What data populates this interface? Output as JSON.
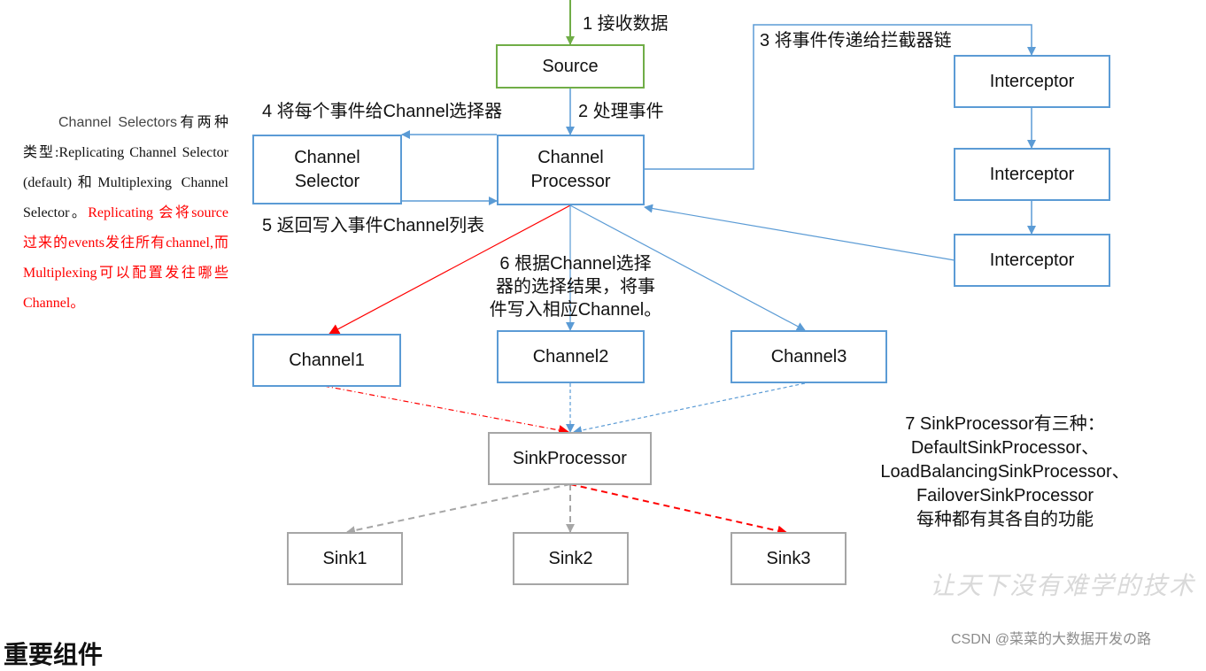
{
  "nodes": {
    "source": "Source",
    "channel_selector": [
      "Channel",
      "Selector"
    ],
    "channel_processor": [
      "Channel",
      "Processor"
    ],
    "interceptors": [
      "Interceptor",
      "Interceptor",
      "Interceptor"
    ],
    "channels": [
      "Channel1",
      "Channel2",
      "Channel3"
    ],
    "sink_processor": "SinkProcessor",
    "sinks": [
      "Sink1",
      "Sink2",
      "Sink3"
    ]
  },
  "steps": {
    "step1": "1 接收数据",
    "step2": "2 处理事件",
    "step3": "3 将事件传递给拦截器链",
    "step4": "4 将每个事件给Channel选择器",
    "step5": "5 返回写入事件Channel列表",
    "step6": [
      "6 根据Channel选择",
      "器的选择结果，将事",
      "件写入相应Channel。"
    ],
    "step7": [
      "7 SinkProcessor有三种：",
      "DefaultSinkProcessor、",
      "LoadBalancingSinkProcessor、",
      "FailoverSinkProcessor",
      "每种都有其各自的功能"
    ]
  },
  "side_note": {
    "black_part": [
      "Channel  Selectors",
      "有两种类型:Replicating Channel Selector (default)和Multiplexing Channel Selector。"
    ],
    "red_part": "Replicating 会将source过来的events发往所有channel,而Multiplexing可以配置发往哪些Channel。"
  },
  "colors": {
    "blue": "#5b9bd5",
    "green": "#70ad47",
    "gray": "#a6a6a6",
    "red": "#ff0000"
  },
  "watermark": "让天下没有难学的技术",
  "csdn_credit": "CSDN @菜菜的大数据开发の路",
  "section_heading": "重要组件"
}
